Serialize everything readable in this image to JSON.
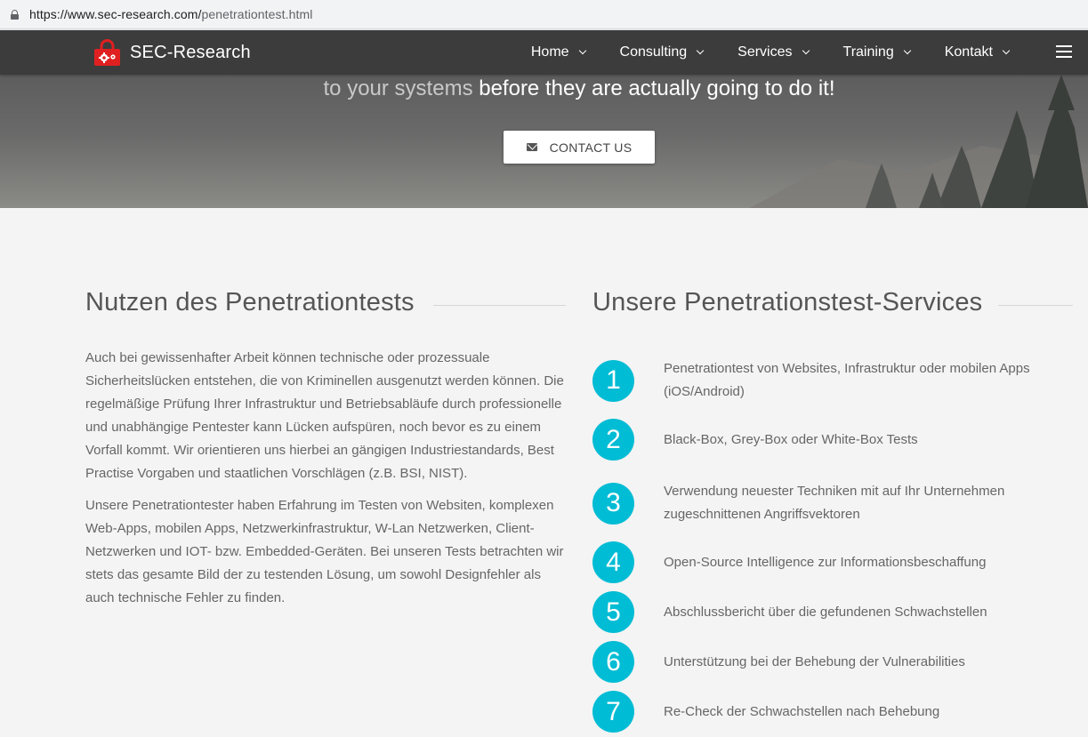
{
  "browser": {
    "url_host": "https://www.sec-research.com/",
    "url_path": "penetrationtest.html"
  },
  "navbar": {
    "brand": "SEC-Research",
    "items": [
      {
        "label": "Home"
      },
      {
        "label": "Consulting"
      },
      {
        "label": "Services"
      },
      {
        "label": "Training"
      },
      {
        "label": "Kontakt"
      }
    ]
  },
  "hero": {
    "tagline_muted": "to your systems",
    "tagline_main": " before they are actually going to do it!",
    "contact_button": "CONTACT US"
  },
  "left": {
    "title": "Nutzen des Penetrationtests",
    "paragraphs": [
      "Auch bei gewissenhafter Arbeit können technische oder prozessuale Sicherheitslücken entstehen, die von Kriminellen ausgenutzt werden können. Die regelmäßige Prüfung Ihrer Infrastruktur und Betriebsabläufe durch professionelle und unabhängige Pentester kann Lücken aufspüren, noch bevor es zu einem Vorfall kommt. Wir orientieren uns hierbei an gängigen Industriestandards, Best Practise Vorgaben und staatlichen Vorschlägen (z.B. BSI, NIST).",
      "Unsere Penetrationtester haben Erfahrung im Testen von Websiten, komplexen Web-Apps, mobilen Apps, Netzwerkinfrastruktur, W-Lan Netzwerken, Client-Netzwerken und IOT- bzw. Embedded-Geräten. Bei unseren Tests betrachten wir stets das gesamte Bild der zu testenden Lösung, um sowohl Designfehler als auch technische Fehler zu finden."
    ]
  },
  "right": {
    "title": "Unsere Penetrationstest-Services",
    "services": [
      {
        "num": "1",
        "text": "Penetrationtest von Websites, Infrastruktur oder mobilen Apps (iOS/Android)"
      },
      {
        "num": "2",
        "text": "Black-Box, Grey-Box oder White-Box Tests"
      },
      {
        "num": "3",
        "text": "Verwendung neuester Techniken mit auf Ihr Unternehmen zugeschnittenen Angriffsvektoren"
      },
      {
        "num": "4",
        "text": "Open-Source Intelligence zur Informationsbeschaffung"
      },
      {
        "num": "5",
        "text": "Abschlussbericht über die gefundenen Schwachstellen"
      },
      {
        "num": "6",
        "text": "Unterstützung bei der Behebung der Vulnerabilities"
      },
      {
        "num": "7",
        "text": "Re-Check der Schwachstellen nach Behebung"
      }
    ]
  },
  "colors": {
    "accent": "#00bcd4",
    "navbar": "#3c3c3c",
    "logo_red": "#e02020"
  },
  "icons": [
    "lock-icon",
    "brand-logo-icon",
    "chevron-down-icon",
    "menu-icon",
    "mail-icon"
  ]
}
